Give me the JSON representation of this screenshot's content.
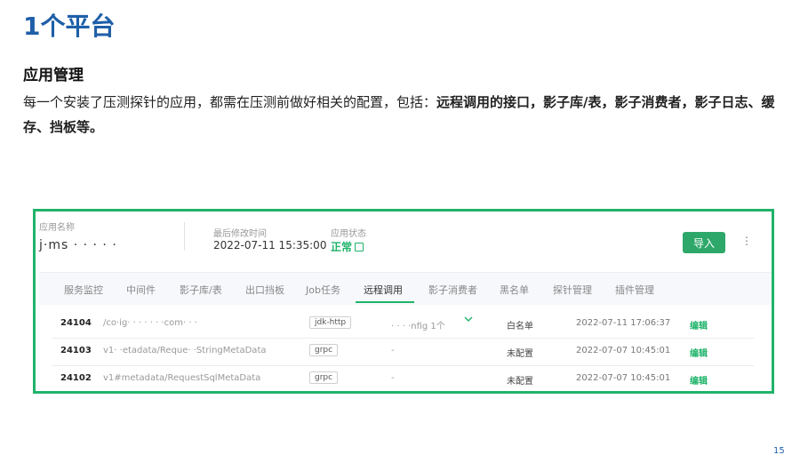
{
  "slide": {
    "title": "1个平台",
    "section_title": "应用管理",
    "desc_prefix": "每一个安装了压测探针的应用，都需在压测前做好相关的配置，包括：",
    "desc_bold_1": "远程调用的接口，影子库/表，影子消费者，影子日志、缓存、挡板",
    "desc_suffix": "等。",
    "page_number": "15"
  },
  "app": {
    "name_label": "应用名称",
    "name_value": "j·ms  ·  ·  ·  ·  ·",
    "last_modified_label": "最后修改时间",
    "last_modified_value": "2022-07-11 15:35:00",
    "status_label": "应用状态",
    "status_value": "正常",
    "import_label": "导入",
    "more_label": "⋮"
  },
  "tabs": [
    "服务监控",
    "中间件",
    "影子库/表",
    "出口挡板",
    "Job任务",
    "远程调用",
    "影子消费者",
    "黑名单",
    "探针管理",
    "插件管理"
  ],
  "rows": [
    {
      "id": "24104",
      "path": "/co·ig·  ·  ·  ·  ·  ·  ·com·  ·  ·",
      "type": "jdk-http",
      "cfg": "·  ·  ·  ·nfig  1个",
      "list": "白名单",
      "time": "2022-07-11 17:06:37",
      "action": "编辑"
    },
    {
      "id": "24103",
      "path": "v1·  ·etadata/Reque·  ·StringMetaData",
      "type": "grpc",
      "cfg": "-",
      "list": "未配置",
      "time": "2022-07-07 10:45:01",
      "action": "编辑"
    },
    {
      "id": "24102",
      "path": "v1#metadata/RequestSqlMetaData",
      "type": "grpc",
      "cfg": "-",
      "list": "未配置",
      "time": "2022-07-07 10:45:01",
      "action": "编辑"
    }
  ]
}
